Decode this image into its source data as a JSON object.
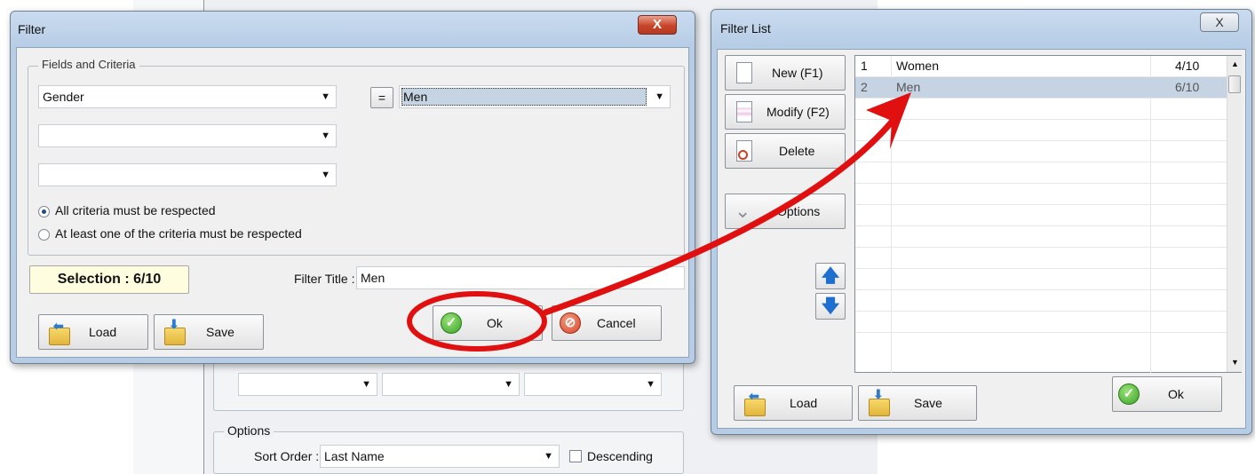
{
  "filter_dialog": {
    "title": "Filter",
    "close_label": "X",
    "group_title": "Fields and Criteria",
    "field1_value": "Gender",
    "operator_label": "=",
    "criteria1_value": "Men",
    "field2_value": "",
    "field3_value": "",
    "radio_all": "All criteria must be respected",
    "radio_one": "At least one of the criteria must be respected",
    "selection_label": "Selection : 6/10",
    "filter_title_label": "Filter Title :",
    "filter_title_value": "Men",
    "load_label": "Load",
    "save_label": "Save",
    "ok_label": "Ok",
    "cancel_label": "Cancel"
  },
  "filter_list": {
    "title": "Filter List",
    "close_label": "X",
    "new_label": "New (F1)",
    "modify_label": "Modify (F2)",
    "delete_label": "Delete",
    "options_label": "Options",
    "rows": [
      {
        "num": "1",
        "name": "Women",
        "count": "4/10"
      },
      {
        "num": "2",
        "name": "Men",
        "count": "6/10"
      }
    ],
    "load_label": "Load",
    "save_label": "Save",
    "ok_label": "Ok"
  },
  "background": {
    "options_title": "Options",
    "sort_order_label": "Sort Order :",
    "sort_order_value": "Last Name",
    "descending_label": "Descending"
  },
  "colors": {
    "annotation": "#e01010",
    "selected_row": "#c5d3e2",
    "selection_badge": "#fffde0"
  }
}
